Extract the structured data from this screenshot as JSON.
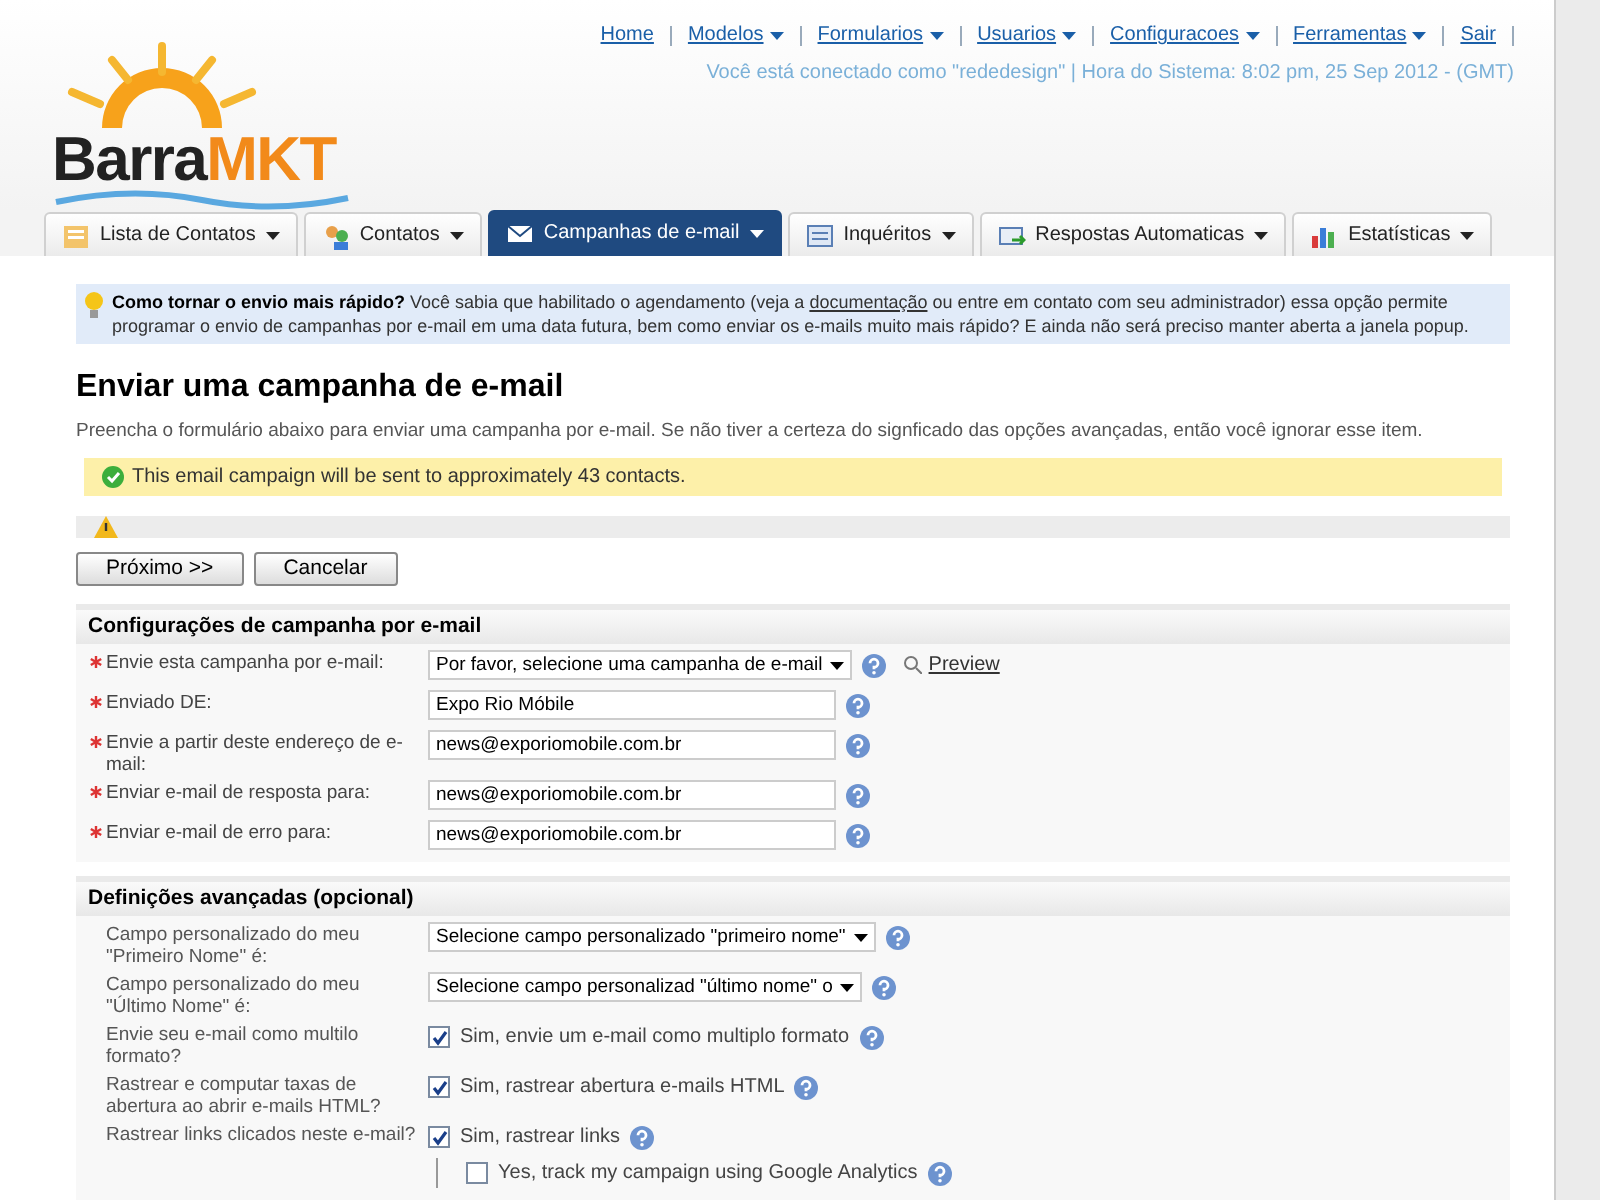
{
  "top_nav": [
    {
      "label": "Home",
      "dropdown": false
    },
    {
      "label": "Modelos",
      "dropdown": true
    },
    {
      "label": "Formularios",
      "dropdown": true
    },
    {
      "label": "Usuarios",
      "dropdown": true
    },
    {
      "label": "Configuracoes",
      "dropdown": true
    },
    {
      "label": "Ferramentas",
      "dropdown": true
    },
    {
      "label": "Sair",
      "dropdown": false
    }
  ],
  "session_info": "Você está conectado como \"rededesign\" | Hora do Sistema: 8:02 pm, 25 Sep 2012 - (GMT)",
  "logo": {
    "part_1": "Barra",
    "part_2": "MKT"
  },
  "tabs": [
    {
      "label": "Lista de Contatos",
      "selected": false
    },
    {
      "label": "Contatos",
      "selected": false
    },
    {
      "label": "Campanhas de e-mail",
      "selected": true
    },
    {
      "label": "Inquéritos",
      "selected": false
    },
    {
      "label": "Respostas Automaticas",
      "selected": false
    },
    {
      "label": "Estatísticas",
      "selected": false
    }
  ],
  "tip": {
    "title": "Como tornar o envio mais rápido?",
    "before_link": "Você sabia que habilitado o agendamento (veja a",
    "link": "documentação",
    "after_link": "ou entre em contato com seu administrador) essa opção permite programar o envio de campanhas por e-mail em uma data futura, bem como enviar os e-mails muito mais rápido? E ainda não será preciso manter aberta a janela popup."
  },
  "page_title": "Enviar uma campanha de e-mail",
  "description": "Preencha o formulário abaixo para enviar uma campanha por e-mail. Se não tiver a certeza do signficado das opções avançadas, então você ignorar esse item.",
  "notice": "This email campaign will be sent to approximately 43 contacts.",
  "buttons": [
    "Próximo >>",
    "Cancelar"
  ],
  "sections": [
    {
      "title": "Configurações de campanha por e-mail",
      "rows": [
        {
          "kind": "select",
          "label": "Envie esta campanha por e-mail:",
          "required": true,
          "value": "Por favor, selecione uma campanha de e-mail",
          "link": "Preview"
        },
        {
          "kind": "text",
          "label": "Enviado DE:",
          "required": true,
          "value": "Expo Rio Móbile"
        },
        {
          "kind": "text",
          "label": "Envie a partir deste endereço de e-mail:",
          "required": true,
          "value": "news@exporiomobile.com.br"
        },
        {
          "kind": "text",
          "label": "Enviar e-mail de resposta para:",
          "required": true,
          "value": "news@exporiomobile.com.br"
        },
        {
          "kind": "text",
          "label": "Enviar e-mail de erro para:",
          "required": true,
          "value": "news@exporiomobile.com.br"
        }
      ]
    },
    {
      "title": "Definições avançadas (opcional)",
      "rows": [
        {
          "kind": "select",
          "label": "Campo personalizado do meu \"Primeiro Nome\" é:",
          "required": false,
          "value": "Selecione campo personalizado \"primeiro nome\""
        },
        {
          "kind": "select",
          "label": "Campo personalizado do meu \"Último Nome\" é:",
          "required": false,
          "value": "Selecione campo personalizad \"último nome\" o"
        },
        {
          "kind": "checkbox",
          "label": "Envie seu e-mail como multilo formato?",
          "required": false,
          "value": "Sim, envie um e-mail como multiplo formato",
          "checked": true
        },
        {
          "kind": "checkbox",
          "label": "Rastrear e computar taxas de abertura ao abrir e-mails HTML?",
          "required": false,
          "value": "Sim, rastrear abertura e-mails HTML",
          "checked": true
        },
        {
          "kind": "checkbox",
          "label": "Rastrear links clicados neste e-mail?",
          "required": false,
          "value": "Sim, rastrear links",
          "checked": true
        },
        {
          "kind": "subcheckbox",
          "value": "Yes, track my campaign using Google Analytics",
          "checked": false
        }
      ]
    }
  ]
}
